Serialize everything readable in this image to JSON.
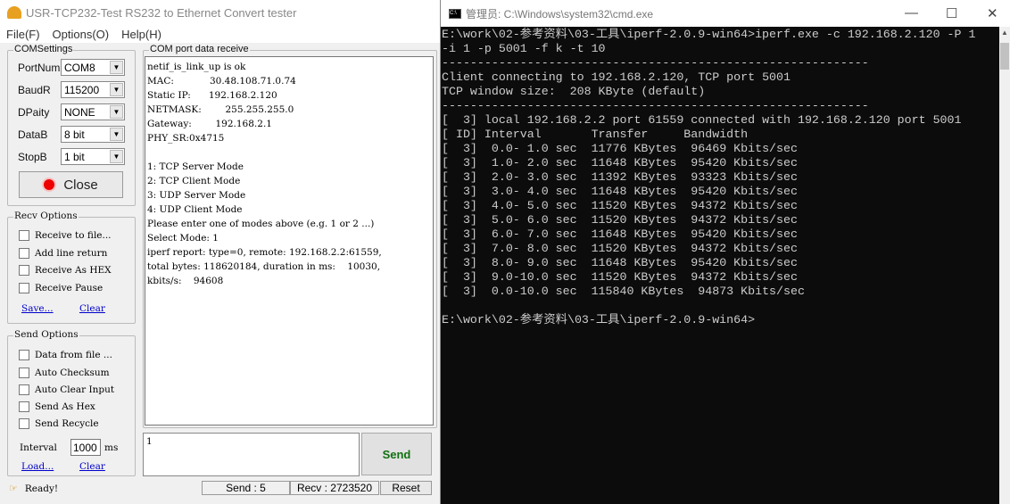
{
  "app": {
    "title": "USR-TCP232-Test  RS232 to Ethernet Convert tester",
    "menu": [
      "File(F)",
      "Options(O)",
      "Help(H)"
    ],
    "com_settings": {
      "title": "COMSettings",
      "fields": [
        {
          "label": "PortNum",
          "value": "COM8"
        },
        {
          "label": "BaudR",
          "value": "115200"
        },
        {
          "label": "DPaity",
          "value": "NONE"
        },
        {
          "label": "DataB",
          "value": "8 bit"
        },
        {
          "label": "StopB",
          "value": "1 bit"
        }
      ],
      "close_label": "Close"
    },
    "recv_options": {
      "title": "Recv Options",
      "items": [
        "Receive to file...",
        "Add line return",
        "Receive As HEX",
        "Receive Pause"
      ],
      "save": "Save...",
      "clear": "Clear"
    },
    "send_options": {
      "title": "Send Options",
      "items": [
        "Data from file ...",
        "Auto Checksum",
        "Auto Clear Input",
        "Send As Hex",
        "Send Recycle"
      ],
      "interval_label": "Interval",
      "interval_value": "1000",
      "interval_unit": "ms",
      "load": "Load...",
      "clear": "Clear"
    },
    "receive": {
      "title": "COM port data receive",
      "text": "netif_is_link_up is ok\nMAC:            30.48.108.71.0.74\nStatic IP:      192.168.2.120\nNETMASK:        255.255.255.0\nGateway:        192.168.2.1\nPHY_SR:0x4715\n\n1: TCP Server Mode\n2: TCP Client Mode\n3: UDP Server Mode\n4: UDP Client Mode\nPlease enter one of modes above (e.g. 1 or 2 ...)\nSelect Mode: 1\niperf report: type=0, remote: 192.168.2.2:61559,\ntotal bytes: 118620184, duration in ms:    10030,\nkbits/s:    94608"
    },
    "send_input": "1",
    "send_label": "Send",
    "status": {
      "ready": "Ready!",
      "send": "Send : 5",
      "recv": "Recv : 2723520",
      "reset": "Reset"
    }
  },
  "cmd": {
    "title": "管理员: C:\\Windows\\system32\\cmd.exe",
    "output": "E:\\work\\02-参考资料\\03-工具\\iperf-2.0.9-win64>iperf.exe -c 192.168.2.120 -P 1\n-i 1 -p 5001 -f k -t 10\n------------------------------------------------------------\nClient connecting to 192.168.2.120, TCP port 5001\nTCP window size:  208 KByte (default)\n------------------------------------------------------------\n[  3] local 192.168.2.2 port 61559 connected with 192.168.2.120 port 5001\n[ ID] Interval       Transfer     Bandwidth\n[  3]  0.0- 1.0 sec  11776 KBytes  96469 Kbits/sec\n[  3]  1.0- 2.0 sec  11648 KBytes  95420 Kbits/sec\n[  3]  2.0- 3.0 sec  11392 KBytes  93323 Kbits/sec\n[  3]  3.0- 4.0 sec  11648 KBytes  95420 Kbits/sec\n[  3]  4.0- 5.0 sec  11520 KBytes  94372 Kbits/sec\n[  3]  5.0- 6.0 sec  11520 KBytes  94372 Kbits/sec\n[  3]  6.0- 7.0 sec  11648 KBytes  95420 Kbits/sec\n[  3]  7.0- 8.0 sec  11520 KBytes  94372 Kbits/sec\n[  3]  8.0- 9.0 sec  11648 KBytes  95420 Kbits/sec\n[  3]  9.0-10.0 sec  11520 KBytes  94372 Kbits/sec\n[  3]  0.0-10.0 sec  115840 KBytes  94873 Kbits/sec\n\nE:\\work\\02-参考资料\\03-工具\\iperf-2.0.9-win64>"
  }
}
